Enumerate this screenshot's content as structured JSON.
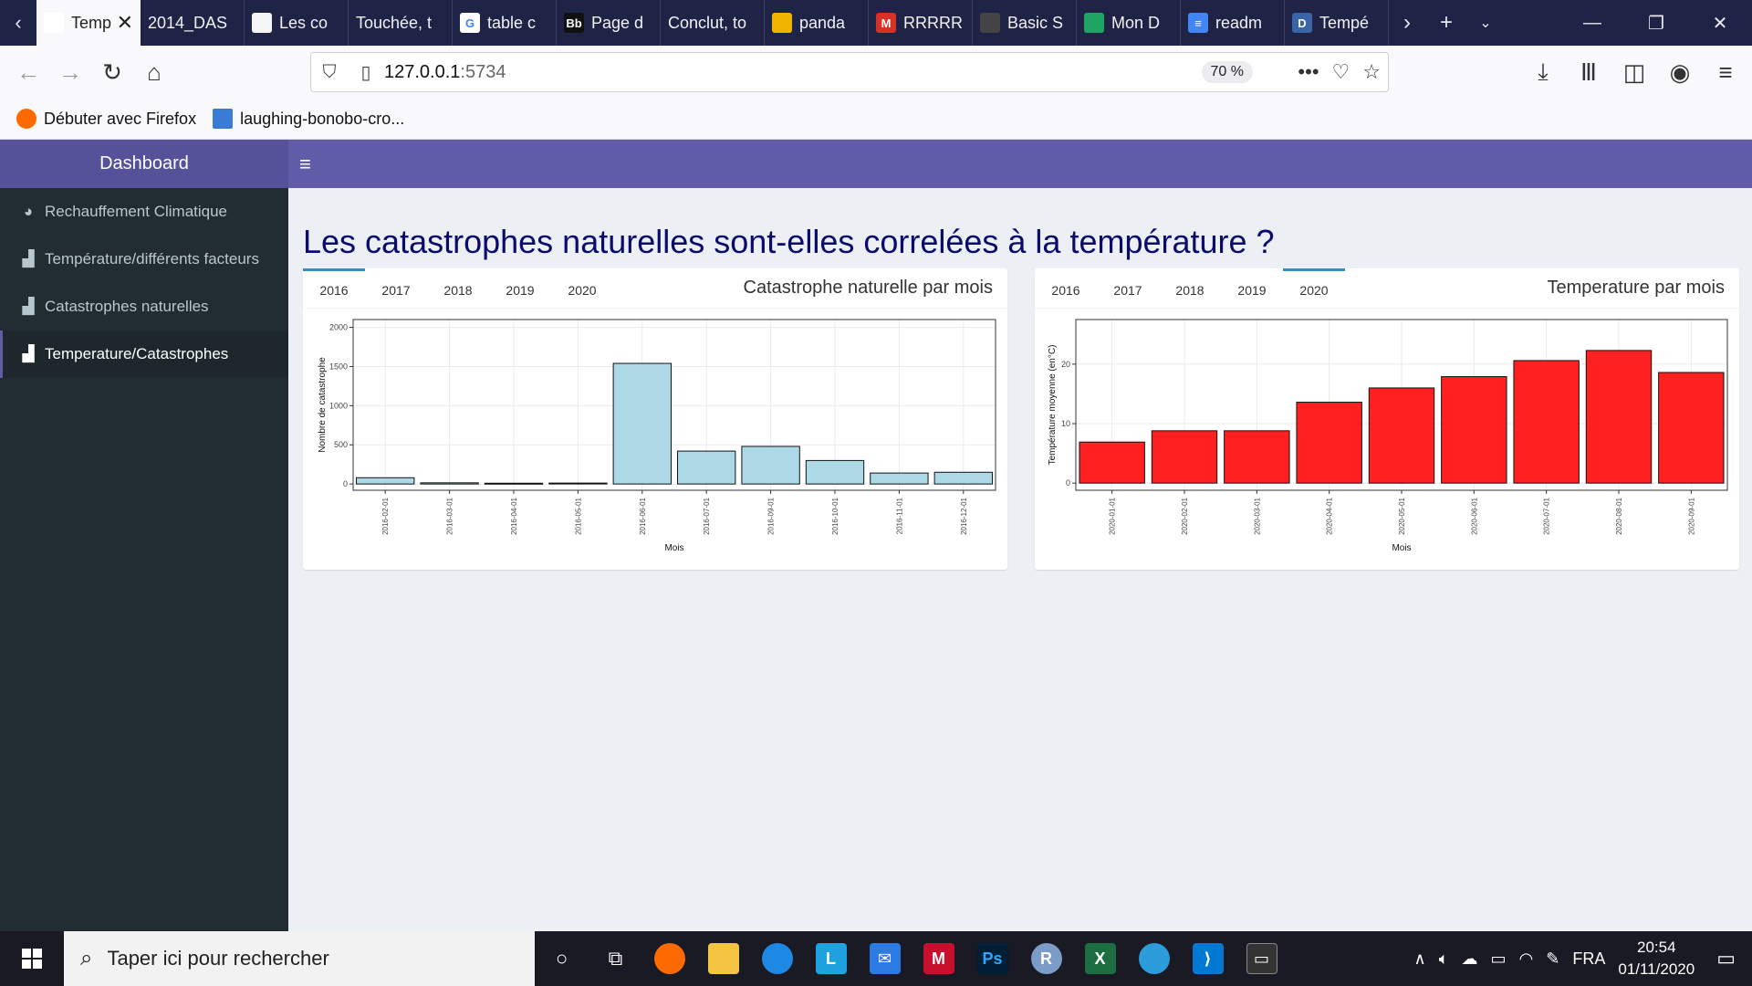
{
  "browser": {
    "tabs": [
      {
        "label": "Tempér",
        "favicon_color": "#ffffff",
        "favicon_text": "",
        "active": true
      },
      {
        "label": "2014_DAS",
        "favicon_color": "",
        "favicon_text": "",
        "active": false
      },
      {
        "label": "Les co",
        "favicon_color": "#f5f5f5",
        "favicon_text": "",
        "active": false
      },
      {
        "label": "Touchée, t",
        "favicon_color": "",
        "favicon_text": "",
        "active": false
      },
      {
        "label": "table c",
        "favicon_color": "#ffffff",
        "favicon_text": "G",
        "active": false
      },
      {
        "label": "Page d",
        "favicon_color": "#111111",
        "favicon_text": "Bb",
        "active": false
      },
      {
        "label": "Conclut, to",
        "favicon_color": "",
        "favicon_text": "",
        "active": false
      },
      {
        "label": "panda",
        "favicon_color": "#f0b400",
        "favicon_text": "",
        "active": false
      },
      {
        "label": "RRRRR",
        "favicon_color": "#d93025",
        "favicon_text": "M",
        "active": false
      },
      {
        "label": "Basic S",
        "favicon_color": "#444444",
        "favicon_text": "",
        "active": false
      },
      {
        "label": "Mon D",
        "favicon_color": "#1fa463",
        "favicon_text": "",
        "active": false
      },
      {
        "label": "readm",
        "favicon_color": "#4285f4",
        "favicon_text": "≡",
        "active": false
      },
      {
        "label": "Tempé",
        "favicon_color": "#3a64a8",
        "favicon_text": "D",
        "active": false
      }
    ],
    "url_host": "127.0.0.1",
    "url_port": ":5734",
    "zoom": "70 %",
    "bookmarks": [
      {
        "label": "Débuter avec Firefox",
        "color": "#ff6a00"
      },
      {
        "label": "laughing-bonobo-cro...",
        "color": "#3a7bd5"
      }
    ]
  },
  "app": {
    "brand": "Dashboard",
    "toggle_icon": "≡",
    "sidebar": [
      {
        "label": "Rechauffement Climatique",
        "icon": "dashboard-icon",
        "active": false
      },
      {
        "label": "Température/différents facteurs",
        "icon": "bar-chart-icon",
        "active": false
      },
      {
        "label": "Catastrophes naturelles",
        "icon": "bar-chart-icon",
        "active": false
      },
      {
        "label": "Temperature/Catastrophes",
        "icon": "bar-chart-icon",
        "active": true
      }
    ],
    "page_title": "Les catastrophes naturelles sont-elles correlées à la température ?",
    "left_box": {
      "title": "Catastrophe naturelle par mois",
      "tabs": [
        "2016",
        "2017",
        "2018",
        "2019",
        "2020"
      ],
      "active_tab": "2016"
    },
    "right_box": {
      "title": "Temperature par mois",
      "tabs": [
        "2016",
        "2017",
        "2018",
        "2019",
        "2020"
      ],
      "active_tab": "2020"
    }
  },
  "chart_data": [
    {
      "type": "bar",
      "xlabel": "Mois",
      "ylabel": "Nombre de catastrophe",
      "categories": [
        "2016-02-01",
        "2016-03-01",
        "2016-04-01",
        "2016-05-01",
        "2016-06-01",
        "2016-07-01",
        "2016-09-01",
        "2016-10-01",
        "2016-11-01",
        "2016-12-01"
      ],
      "values": [
        80,
        15,
        10,
        12,
        1540,
        420,
        480,
        300,
        140,
        150
      ],
      "ylim": [
        -80,
        2100
      ],
      "yticks": [
        0,
        500,
        1000,
        1500,
        2000
      ],
      "bar_color": "#add8e6",
      "grid": true
    },
    {
      "type": "bar",
      "xlabel": "Mois",
      "ylabel": "Température moyenne (en°C)",
      "categories": [
        "2020-01-01",
        "2020-02-01",
        "2020-03-01",
        "2020-04-01",
        "2020-05-01",
        "2020-06-01",
        "2020-07-01",
        "2020-08-01",
        "2020-09-01"
      ],
      "values": [
        6.9,
        8.8,
        8.8,
        13.6,
        16.0,
        17.9,
        20.6,
        22.3,
        18.6
      ],
      "ylim": [
        -1.2,
        27.5
      ],
      "yticks": [
        0,
        10,
        20
      ],
      "bar_color": "#ff2020",
      "grid": true
    }
  ],
  "taskbar": {
    "search_placeholder": "Taper ici pour rechercher",
    "language": "FRA",
    "time": "20:54",
    "date": "01/11/2020"
  }
}
